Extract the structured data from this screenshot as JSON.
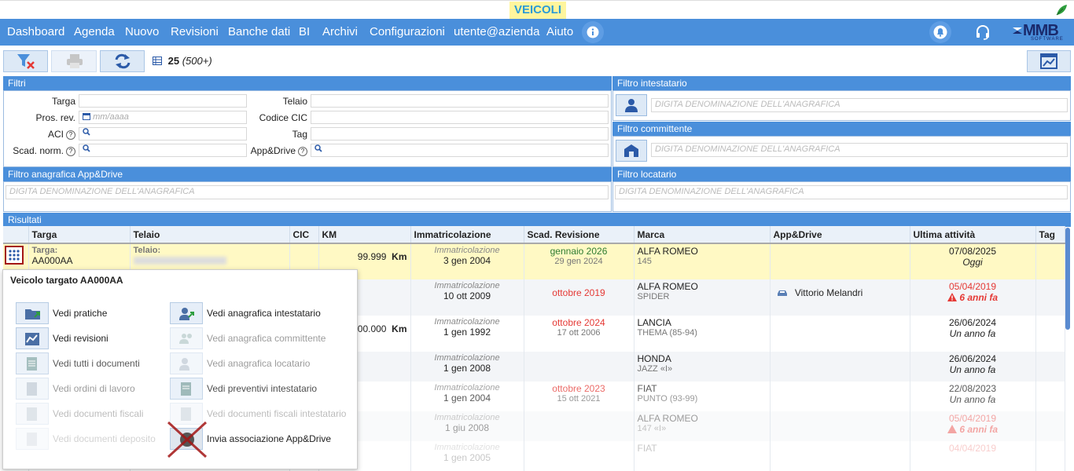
{
  "app": {
    "title": "VEICOLI"
  },
  "menu": {
    "items": [
      "Dashboard",
      "Agenda",
      "Nuovo",
      "Revisioni",
      "Banche dati",
      "BI",
      "Archivi",
      "Configurazioni",
      "utente@azienda",
      "Aiuto"
    ],
    "logo": "MMB",
    "logo_sub": "SOFTWARE"
  },
  "toolbar": {
    "count": "25",
    "count_extra": "(500+)"
  },
  "filters": {
    "section_title": "Filtri",
    "targa_label": "Targa",
    "telaio_label": "Telaio",
    "pros_rev_label": "Pros. rev.",
    "date_placeholder": "mm/aaaa",
    "codice_cic_label": "Codice CIC",
    "aci_label": "ACI",
    "tag_label": "Tag",
    "scad_norm_label": "Scad. norm.",
    "appdrive_label": "App&Drive",
    "help_glyph": "?"
  },
  "owner_filters": {
    "intestatario_title": "Filtro intestatario",
    "committente_title": "Filtro committente",
    "appdrive_title": "Filtro anagrafica App&Drive",
    "locatario_title": "Filtro locatario",
    "placeholder": "DIGITA DENOMINAZIONE DELL'ANAGRAFICA"
  },
  "results": {
    "section_title": "Risultati",
    "columns": [
      "Targa",
      "Telaio",
      "CIC",
      "KM",
      "Immatricolazione",
      "Scad. Revisione",
      "Marca",
      "App&Drive",
      "Ultima attività",
      "Tag"
    ],
    "row1": {
      "targa_label": "Targa:",
      "targa": "AA000AA",
      "telaio_label": "Telaio:",
      "km": "99.999",
      "km_unit": "Km",
      "imm_label": "Immatricolazione",
      "imm": "3 gen 2004",
      "rev": "gennaio 2026",
      "rev_sub": "29 gen 2024",
      "marca": "ALFA ROMEO",
      "modello": "145",
      "attivita": "07/08/2025",
      "attivita_sub": "Oggi"
    },
    "row2": {
      "imm_label": "Immatricolazione",
      "imm": "10 ott 2009",
      "rev": "ottobre 2019",
      "marca": "ALFA ROMEO",
      "modello": "SPIDER",
      "appdrive": "Vittorio Melandri",
      "attivita": "05/04/2019",
      "attivita_sub": "6 anni fa"
    },
    "row3": {
      "km": "200.000",
      "km_unit": "Km",
      "imm_label": "Immatricolazione",
      "imm": "1 gen 1992",
      "rev": "ottobre 2024",
      "rev_sub": "17 ott 2006",
      "marca": "LANCIA",
      "modello": "THEMA (85-94)",
      "attivita": "26/06/2024",
      "attivita_sub": "Un anno fa"
    },
    "row4": {
      "imm_label": "Immatricolazione",
      "imm": "1 gen 2008",
      "marca": "HONDA",
      "modello": "JAZZ «I»",
      "attivita": "26/06/2024",
      "attivita_sub": "Un anno fa"
    },
    "row5": {
      "imm_label": "Immatricolazione",
      "imm": "1 gen 2004",
      "rev": "ottobre 2023",
      "rev_sub": "15 ott 2021",
      "marca": "FIAT",
      "modello": "PUNTO (93-99)",
      "attivita": "22/08/2023",
      "attivita_sub": "Un anno fa"
    },
    "row6": {
      "imm_label": "Immatricolazione",
      "imm": "1 giu 2008",
      "marca": "ALFA ROMEO",
      "modello": "147 «I»",
      "attivita": "05/04/2019",
      "attivita_sub": "6 anni fa"
    },
    "row7": {
      "imm_label": "Immatricolazione",
      "imm": "1 gen 2005",
      "marca": "FIAT",
      "attivita": "04/04/2019"
    }
  },
  "popup": {
    "title": "Veicolo targato AA000AA",
    "items": [
      "Vedi pratiche",
      "Vedi anagrafica intestatario",
      "Vedi revisioni",
      "Vedi anagrafica committente",
      "Vedi tutti i documenti",
      "Vedi anagrafica locatario",
      "Vedi ordini di lavoro",
      "Vedi preventivi intestatario",
      "Vedi documenti fiscali",
      "Vedi documenti fiscali intestatario",
      "Vedi documenti deposito",
      "Invia associazione App&Drive"
    ]
  },
  "colors": {
    "accent": "#4a8fdb",
    "highlight_row": "#fff9c4",
    "warning": "#e53935",
    "ok": "#2e7d32"
  }
}
